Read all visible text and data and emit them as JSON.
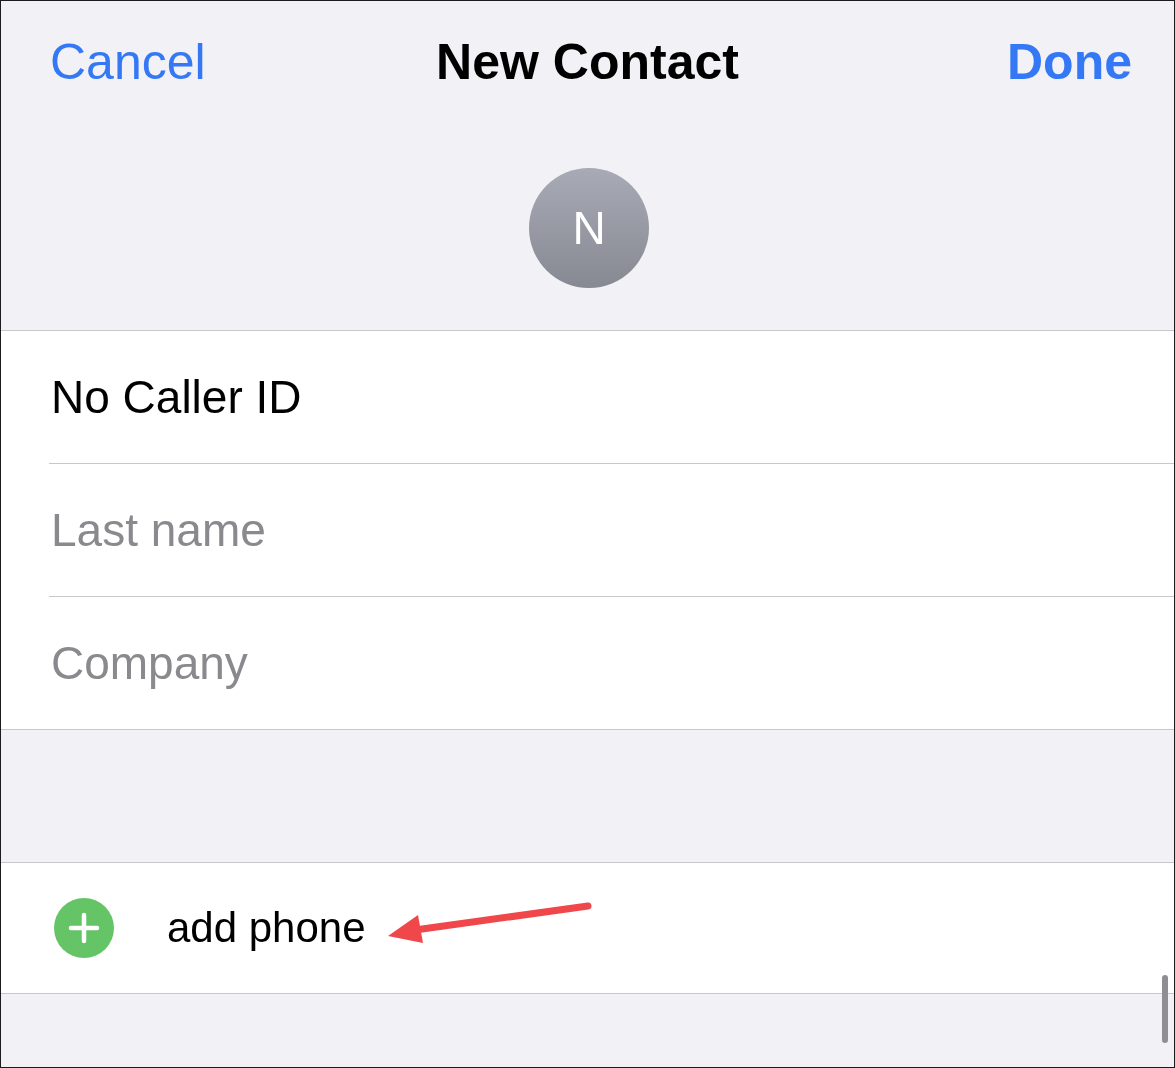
{
  "nav_bar": {
    "left_button": "Cancel",
    "title": "New Contact",
    "right_button": "Done"
  },
  "avatar": {
    "initial": "N"
  },
  "name_fields": [
    {
      "value": "No Caller ID"
    },
    {
      "placeholder": "Last name"
    },
    {
      "placeholder": "Company"
    }
  ],
  "phone_section": {
    "add_label": "add phone"
  }
}
